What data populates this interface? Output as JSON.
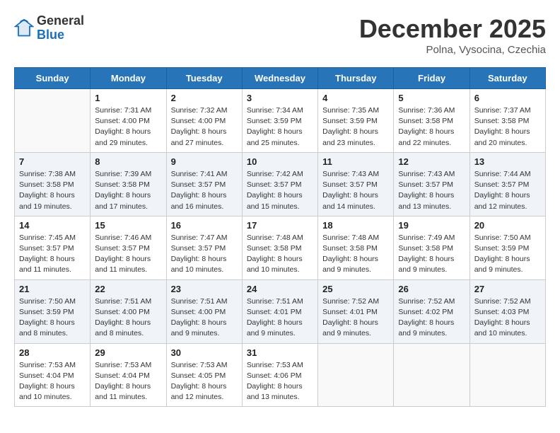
{
  "header": {
    "logo_general": "General",
    "logo_blue": "Blue",
    "month_title": "December 2025",
    "location": "Polna, Vysocina, Czechia"
  },
  "days_of_week": [
    "Sunday",
    "Monday",
    "Tuesday",
    "Wednesday",
    "Thursday",
    "Friday",
    "Saturday"
  ],
  "weeks": [
    [
      {
        "day": "",
        "sunrise": "",
        "sunset": "",
        "daylight": ""
      },
      {
        "day": "1",
        "sunrise": "Sunrise: 7:31 AM",
        "sunset": "Sunset: 4:00 PM",
        "daylight": "Daylight: 8 hours and 29 minutes."
      },
      {
        "day": "2",
        "sunrise": "Sunrise: 7:32 AM",
        "sunset": "Sunset: 4:00 PM",
        "daylight": "Daylight: 8 hours and 27 minutes."
      },
      {
        "day": "3",
        "sunrise": "Sunrise: 7:34 AM",
        "sunset": "Sunset: 3:59 PM",
        "daylight": "Daylight: 8 hours and 25 minutes."
      },
      {
        "day": "4",
        "sunrise": "Sunrise: 7:35 AM",
        "sunset": "Sunset: 3:59 PM",
        "daylight": "Daylight: 8 hours and 23 minutes."
      },
      {
        "day": "5",
        "sunrise": "Sunrise: 7:36 AM",
        "sunset": "Sunset: 3:58 PM",
        "daylight": "Daylight: 8 hours and 22 minutes."
      },
      {
        "day": "6",
        "sunrise": "Sunrise: 7:37 AM",
        "sunset": "Sunset: 3:58 PM",
        "daylight": "Daylight: 8 hours and 20 minutes."
      }
    ],
    [
      {
        "day": "7",
        "sunrise": "Sunrise: 7:38 AM",
        "sunset": "Sunset: 3:58 PM",
        "daylight": "Daylight: 8 hours and 19 minutes."
      },
      {
        "day": "8",
        "sunrise": "Sunrise: 7:39 AM",
        "sunset": "Sunset: 3:58 PM",
        "daylight": "Daylight: 8 hours and 17 minutes."
      },
      {
        "day": "9",
        "sunrise": "Sunrise: 7:41 AM",
        "sunset": "Sunset: 3:57 PM",
        "daylight": "Daylight: 8 hours and 16 minutes."
      },
      {
        "day": "10",
        "sunrise": "Sunrise: 7:42 AM",
        "sunset": "Sunset: 3:57 PM",
        "daylight": "Daylight: 8 hours and 15 minutes."
      },
      {
        "day": "11",
        "sunrise": "Sunrise: 7:43 AM",
        "sunset": "Sunset: 3:57 PM",
        "daylight": "Daylight: 8 hours and 14 minutes."
      },
      {
        "day": "12",
        "sunrise": "Sunrise: 7:43 AM",
        "sunset": "Sunset: 3:57 PM",
        "daylight": "Daylight: 8 hours and 13 minutes."
      },
      {
        "day": "13",
        "sunrise": "Sunrise: 7:44 AM",
        "sunset": "Sunset: 3:57 PM",
        "daylight": "Daylight: 8 hours and 12 minutes."
      }
    ],
    [
      {
        "day": "14",
        "sunrise": "Sunrise: 7:45 AM",
        "sunset": "Sunset: 3:57 PM",
        "daylight": "Daylight: 8 hours and 11 minutes."
      },
      {
        "day": "15",
        "sunrise": "Sunrise: 7:46 AM",
        "sunset": "Sunset: 3:57 PM",
        "daylight": "Daylight: 8 hours and 11 minutes."
      },
      {
        "day": "16",
        "sunrise": "Sunrise: 7:47 AM",
        "sunset": "Sunset: 3:57 PM",
        "daylight": "Daylight: 8 hours and 10 minutes."
      },
      {
        "day": "17",
        "sunrise": "Sunrise: 7:48 AM",
        "sunset": "Sunset: 3:58 PM",
        "daylight": "Daylight: 8 hours and 10 minutes."
      },
      {
        "day": "18",
        "sunrise": "Sunrise: 7:48 AM",
        "sunset": "Sunset: 3:58 PM",
        "daylight": "Daylight: 8 hours and 9 minutes."
      },
      {
        "day": "19",
        "sunrise": "Sunrise: 7:49 AM",
        "sunset": "Sunset: 3:58 PM",
        "daylight": "Daylight: 8 hours and 9 minutes."
      },
      {
        "day": "20",
        "sunrise": "Sunrise: 7:50 AM",
        "sunset": "Sunset: 3:59 PM",
        "daylight": "Daylight: 8 hours and 9 minutes."
      }
    ],
    [
      {
        "day": "21",
        "sunrise": "Sunrise: 7:50 AM",
        "sunset": "Sunset: 3:59 PM",
        "daylight": "Daylight: 8 hours and 8 minutes."
      },
      {
        "day": "22",
        "sunrise": "Sunrise: 7:51 AM",
        "sunset": "Sunset: 4:00 PM",
        "daylight": "Daylight: 8 hours and 8 minutes."
      },
      {
        "day": "23",
        "sunrise": "Sunrise: 7:51 AM",
        "sunset": "Sunset: 4:00 PM",
        "daylight": "Daylight: 8 hours and 9 minutes."
      },
      {
        "day": "24",
        "sunrise": "Sunrise: 7:51 AM",
        "sunset": "Sunset: 4:01 PM",
        "daylight": "Daylight: 8 hours and 9 minutes."
      },
      {
        "day": "25",
        "sunrise": "Sunrise: 7:52 AM",
        "sunset": "Sunset: 4:01 PM",
        "daylight": "Daylight: 8 hours and 9 minutes."
      },
      {
        "day": "26",
        "sunrise": "Sunrise: 7:52 AM",
        "sunset": "Sunset: 4:02 PM",
        "daylight": "Daylight: 8 hours and 9 minutes."
      },
      {
        "day": "27",
        "sunrise": "Sunrise: 7:52 AM",
        "sunset": "Sunset: 4:03 PM",
        "daylight": "Daylight: 8 hours and 10 minutes."
      }
    ],
    [
      {
        "day": "28",
        "sunrise": "Sunrise: 7:53 AM",
        "sunset": "Sunset: 4:04 PM",
        "daylight": "Daylight: 8 hours and 10 minutes."
      },
      {
        "day": "29",
        "sunrise": "Sunrise: 7:53 AM",
        "sunset": "Sunset: 4:04 PM",
        "daylight": "Daylight: 8 hours and 11 minutes."
      },
      {
        "day": "30",
        "sunrise": "Sunrise: 7:53 AM",
        "sunset": "Sunset: 4:05 PM",
        "daylight": "Daylight: 8 hours and 12 minutes."
      },
      {
        "day": "31",
        "sunrise": "Sunrise: 7:53 AM",
        "sunset": "Sunset: 4:06 PM",
        "daylight": "Daylight: 8 hours and 13 minutes."
      },
      {
        "day": "",
        "sunrise": "",
        "sunset": "",
        "daylight": ""
      },
      {
        "day": "",
        "sunrise": "",
        "sunset": "",
        "daylight": ""
      },
      {
        "day": "",
        "sunrise": "",
        "sunset": "",
        "daylight": ""
      }
    ]
  ]
}
